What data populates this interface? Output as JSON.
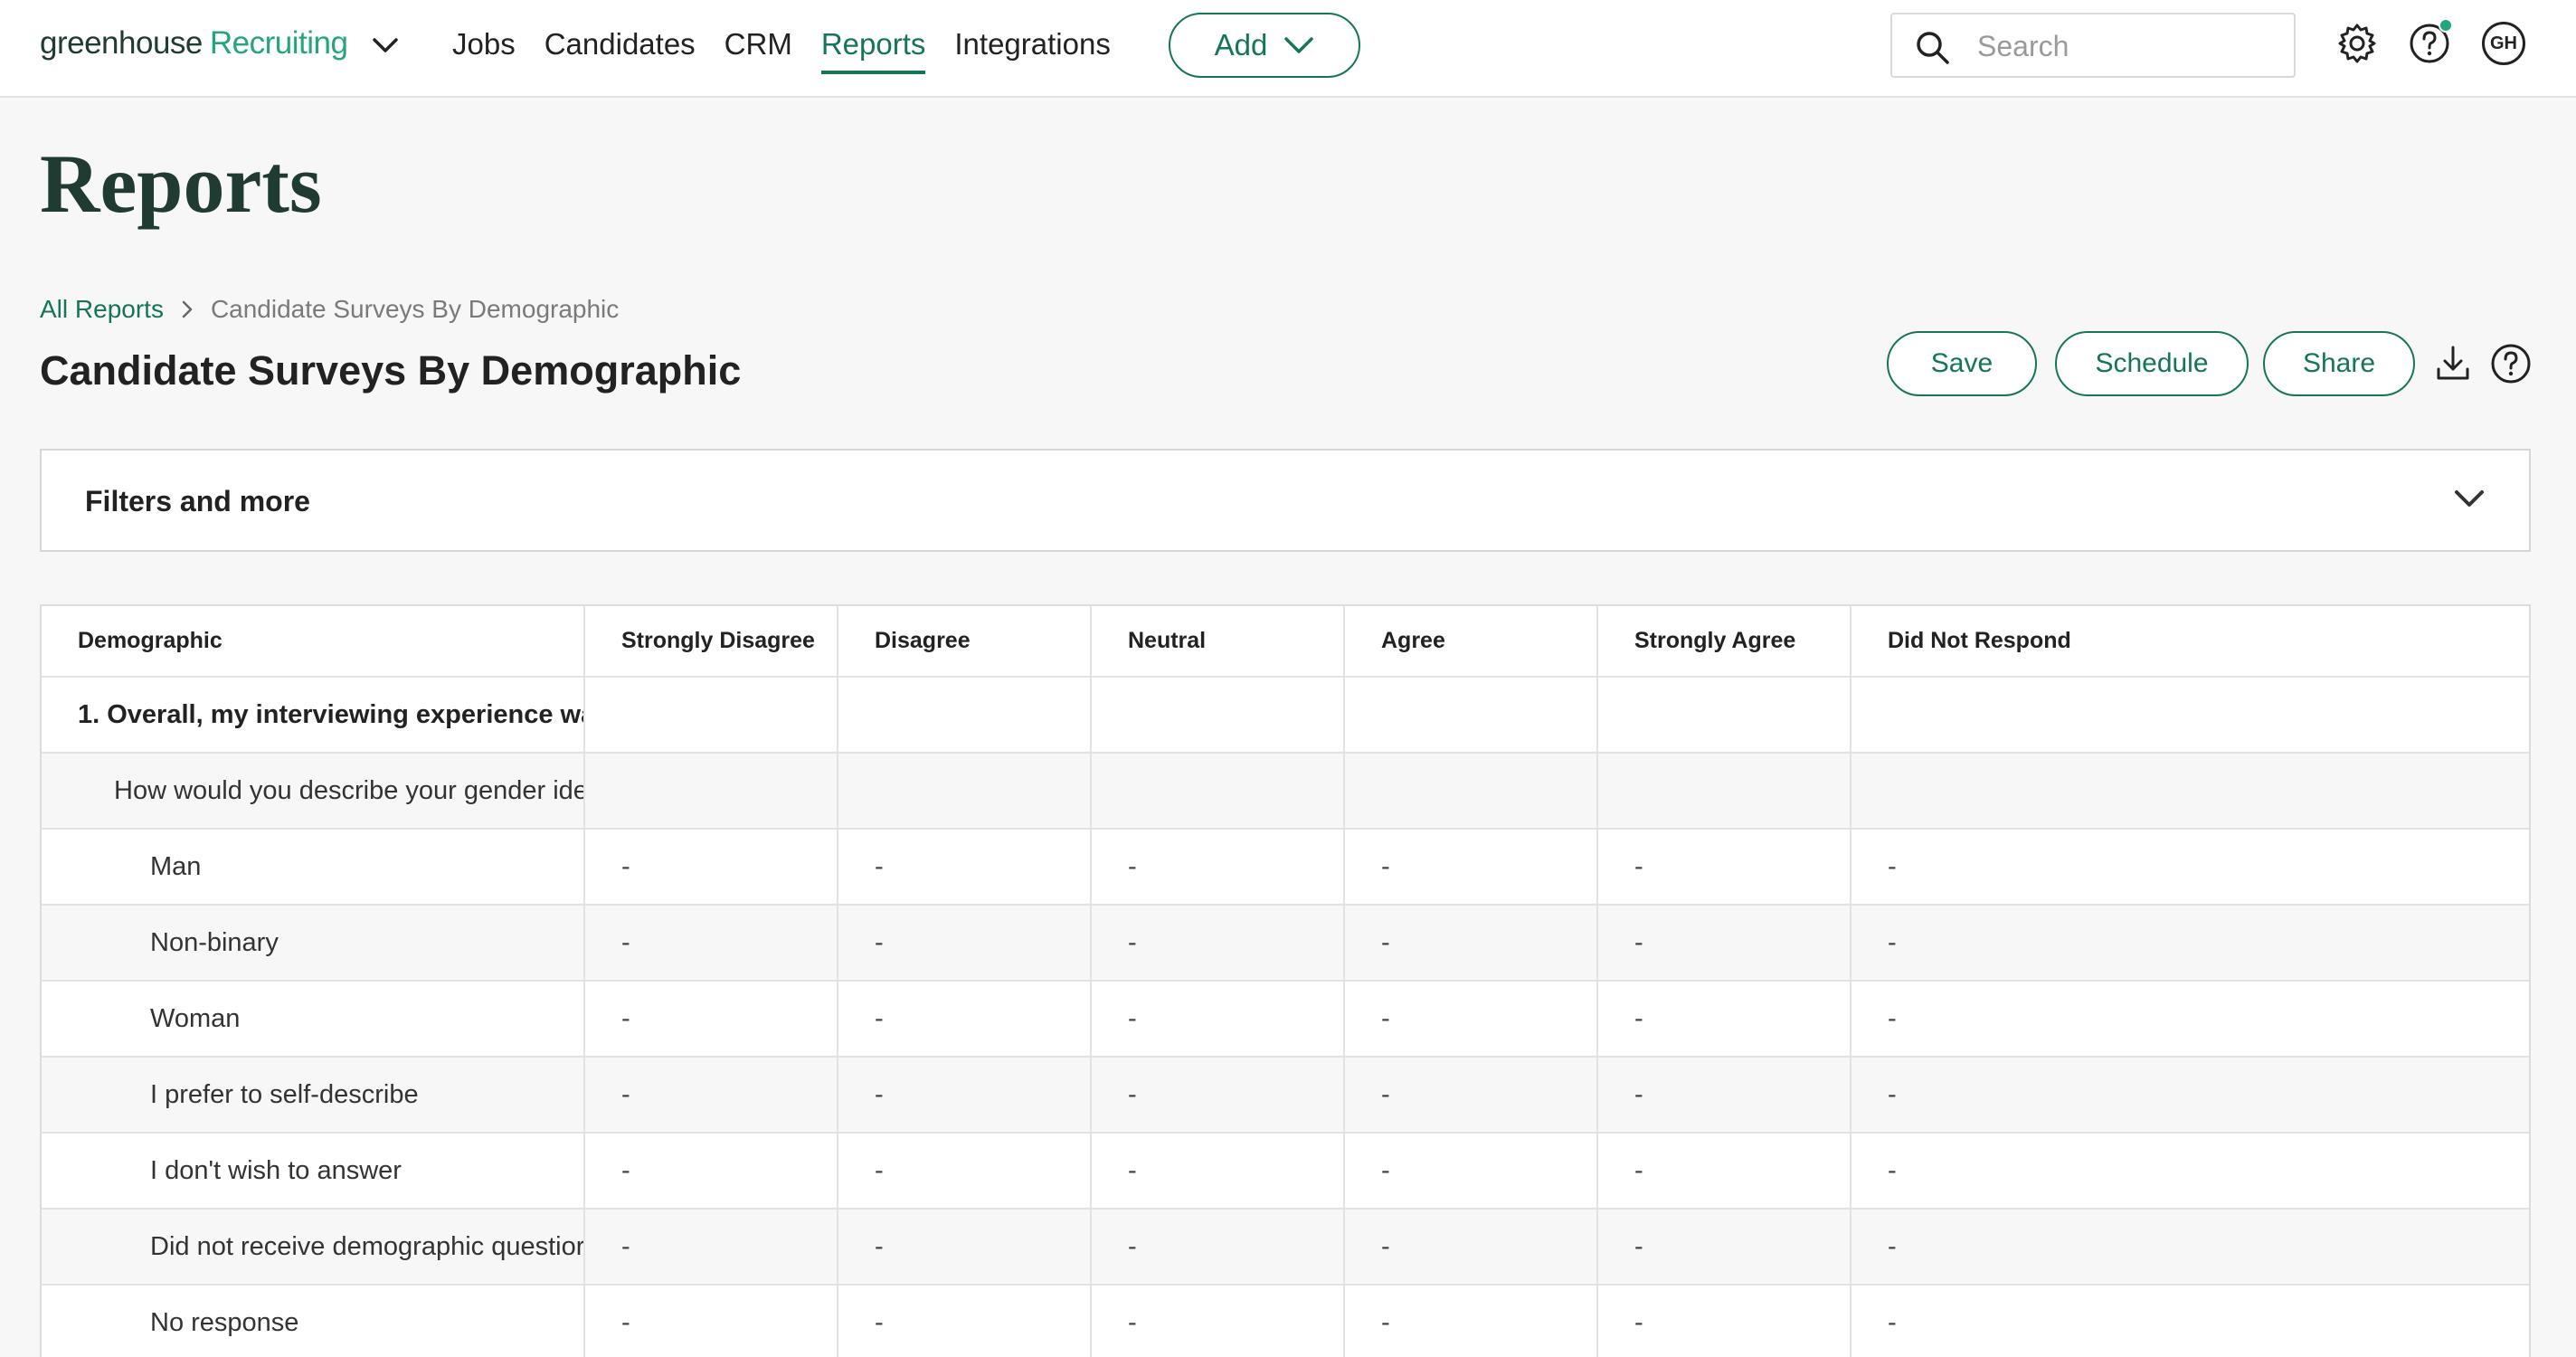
{
  "app": {
    "logo_main": "greenhouse",
    "logo_product": "Recruiting",
    "brand_color": "#15755a"
  },
  "nav": {
    "items": [
      {
        "label": "Jobs",
        "active": false
      },
      {
        "label": "Candidates",
        "active": false
      },
      {
        "label": "CRM",
        "active": false
      },
      {
        "label": "Reports",
        "active": true
      },
      {
        "label": "Integrations",
        "active": false
      }
    ],
    "add_label": "Add",
    "search_placeholder": "Search",
    "avatar_initials": "GH"
  },
  "page": {
    "title": "Reports",
    "breadcrumb_root": "All Reports",
    "breadcrumb_current": "Candidate Surveys By Demographic",
    "report_title": "Candidate Surveys By Demographic",
    "actions": {
      "save": "Save",
      "schedule": "Schedule",
      "share": "Share"
    }
  },
  "filters": {
    "label": "Filters and more"
  },
  "table": {
    "columns": [
      "Demographic",
      "Strongly Disagree",
      "Disagree",
      "Neutral",
      "Agree",
      "Strongly Agree",
      "Did Not Respond"
    ],
    "rows": [
      {
        "level": "q",
        "label": "1. Overall, my interviewing experience wa",
        "values": [
          "",
          "",
          "",
          "",
          "",
          ""
        ]
      },
      {
        "level": "d1",
        "label": "How would you describe your gender ide",
        "values": [
          "",
          "",
          "",
          "",
          "",
          ""
        ]
      },
      {
        "level": "d2",
        "label": "Man",
        "values": [
          "-",
          "-",
          "-",
          "-",
          "-",
          "-"
        ]
      },
      {
        "level": "d2",
        "label": "Non-binary",
        "values": [
          "-",
          "-",
          "-",
          "-",
          "-",
          "-"
        ]
      },
      {
        "level": "d2",
        "label": "Woman",
        "values": [
          "-",
          "-",
          "-",
          "-",
          "-",
          "-"
        ]
      },
      {
        "level": "d2",
        "label": "I prefer to self-describe",
        "values": [
          "-",
          "-",
          "-",
          "-",
          "-",
          "-"
        ]
      },
      {
        "level": "d2",
        "label": "I don't wish to answer",
        "values": [
          "-",
          "-",
          "-",
          "-",
          "-",
          "-"
        ]
      },
      {
        "level": "d2",
        "label": "Did not receive demographic questior",
        "values": [
          "-",
          "-",
          "-",
          "-",
          "-",
          "-"
        ]
      },
      {
        "level": "d2",
        "label": "No response",
        "values": [
          "-",
          "-",
          "-",
          "-",
          "-",
          "-"
        ]
      }
    ]
  }
}
